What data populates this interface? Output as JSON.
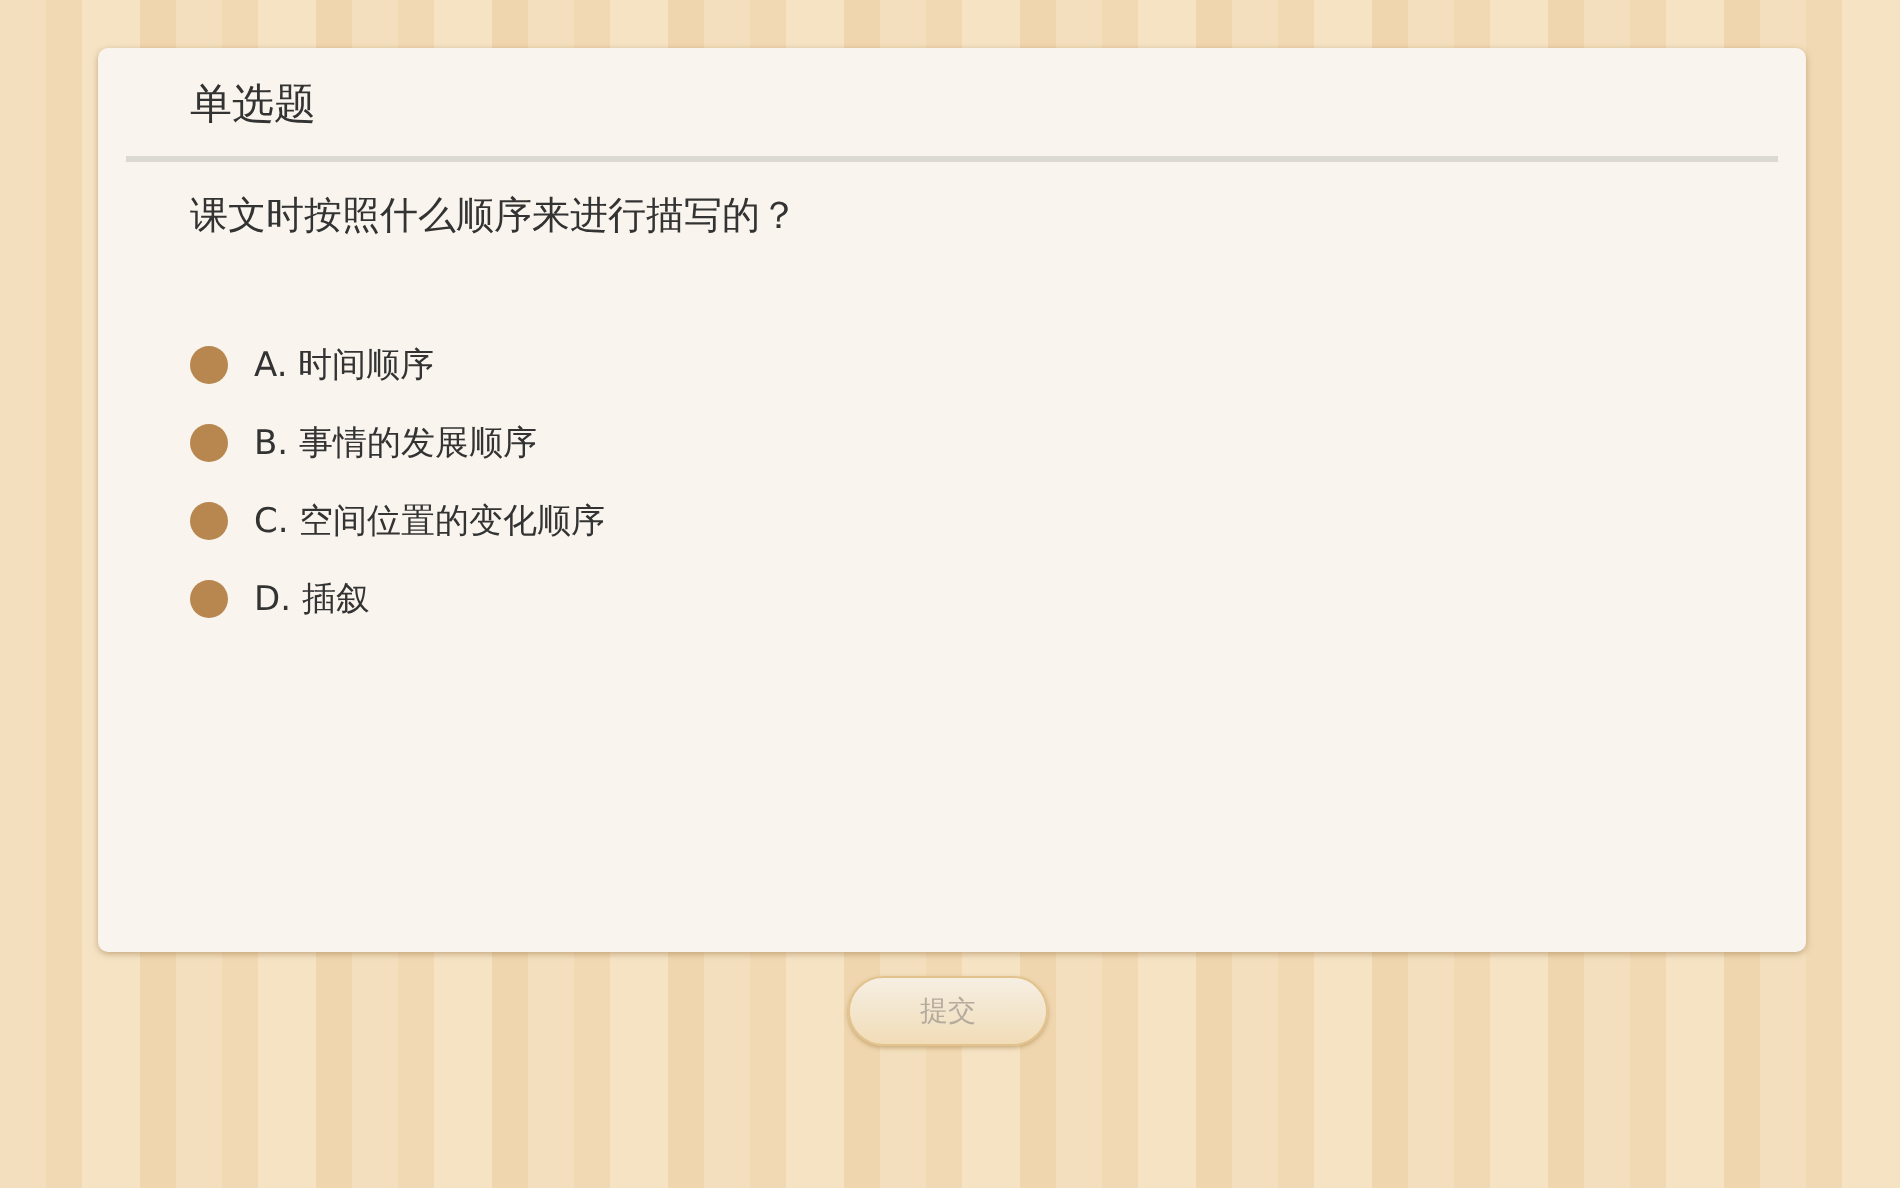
{
  "card": {
    "title": "单选题",
    "question": "课文时按照什么顺序来进行描写的？",
    "options": [
      {
        "label": "A. 时间顺序",
        "selected": false
      },
      {
        "label": "B. 事情的发展顺序",
        "selected": false
      },
      {
        "label": "C. 空间位置的变化顺序",
        "selected": false
      },
      {
        "label": "D. 插叙",
        "selected": false
      }
    ]
  },
  "submit": {
    "label": "提交",
    "disabled": true
  }
}
